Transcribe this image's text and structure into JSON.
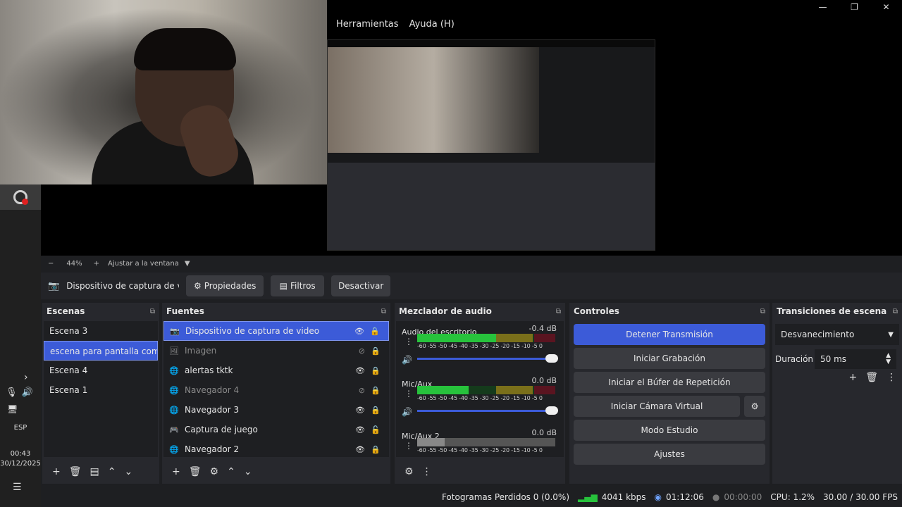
{
  "window": {
    "minimize": "—",
    "maximize": "❐",
    "close": "✕"
  },
  "menu": [
    "Herramientas",
    "Ayuda (H)"
  ],
  "zoom": {
    "minus": "−",
    "value": "44%",
    "plus": "+",
    "fit": "Ajustar a la ventana",
    "caret": "▼"
  },
  "source_toolbar": {
    "name": "Dispositivo de captura de v",
    "properties": "Propiedades",
    "filters": "Filtros",
    "deactivate": "Desactivar"
  },
  "scenes": {
    "title": "Escenas",
    "items": [
      "Escena 3",
      "escena para pantalla completa",
      "Escena 4",
      "Escena 1"
    ],
    "selected_index": 1
  },
  "sources": {
    "title": "Fuentes",
    "items": [
      {
        "label": "Dispositivo de captura de video",
        "icon": "camera-icon",
        "visible": true,
        "locked": true,
        "selected": true
      },
      {
        "label": "Imagen",
        "icon": "image-icon",
        "visible": false,
        "locked": true
      },
      {
        "label": "alertas tktk",
        "icon": "globe-icon",
        "visible": true,
        "locked": true
      },
      {
        "label": "Navegador 4",
        "icon": "globe-icon",
        "visible": false,
        "locked": true
      },
      {
        "label": "Navegador 3",
        "icon": "globe-icon",
        "visible": true,
        "locked": true
      },
      {
        "label": "Captura de juego",
        "icon": "gamepad-icon",
        "visible": true,
        "locked": false
      },
      {
        "label": "Navegador 2",
        "icon": "globe-icon",
        "visible": true,
        "locked": true
      }
    ]
  },
  "mixer": {
    "title": "Mezclador de audio",
    "ticks": "-60 -55 -50 -45 -40 -35 -30 -25 -20 -15 -10 -5 0",
    "channels": [
      {
        "name": "Audio del escritorio",
        "db": "-0.4 dB",
        "level_pct": 0.62,
        "active": true
      },
      {
        "name": "Mic/Aux",
        "db": "0.0 dB",
        "level_pct": 0.37,
        "active": true
      },
      {
        "name": "Mic/Aux 2",
        "db": "0.0 dB",
        "level_pct": 0.2,
        "active": false
      }
    ]
  },
  "controls": {
    "title": "Controles",
    "stop_stream": "Detener Transmisión",
    "start_recording": "Iniciar Grabación",
    "replay_buffer": "Iniciar el Búfer de Repetición",
    "virtual_cam": "Iniciar Cámara Virtual",
    "studio_mode": "Modo Estudio",
    "settings": "Ajustes"
  },
  "transitions": {
    "title": "Transiciones de escena",
    "selected": "Desvanecimiento",
    "duration_label": "Duración",
    "duration_value": "50 ms"
  },
  "status": {
    "dropped_frames": "Fotogramas Perdidos 0 (0.0%)",
    "bitrate": "4041 kbps",
    "stream_time": "01:12:06",
    "rec_time": "00:00:00",
    "cpu": "CPU: 1.2%",
    "fps": "30.00 / 30.00 FPS"
  },
  "taskbar": {
    "lang": "ESP",
    "time": "00:43",
    "date": "30/12/2025"
  },
  "colors": {
    "accent": "#3c5bd8",
    "meter_green": "#27c23c"
  }
}
